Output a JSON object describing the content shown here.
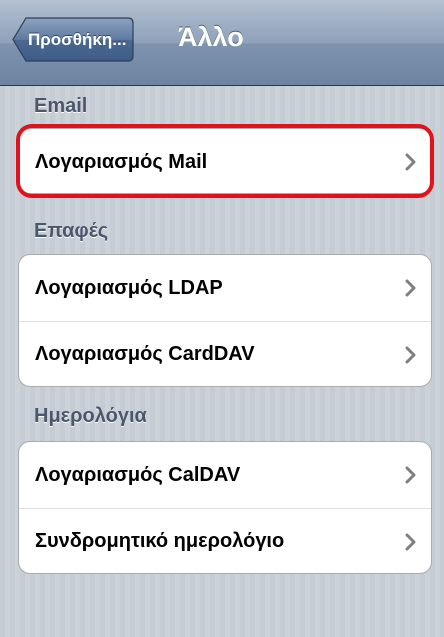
{
  "navbar": {
    "back_label": "Προσθήκη...",
    "title": "Άλλο"
  },
  "sections": [
    {
      "header": "Email",
      "rows": [
        {
          "label": "Λογαριασμός Mail"
        }
      ]
    },
    {
      "header": "Επαφές",
      "rows": [
        {
          "label": "Λογαριασμός LDAP"
        },
        {
          "label": "Λογαριασμός CardDAV"
        }
      ]
    },
    {
      "header": "Ημερολόγια",
      "rows": [
        {
          "label": "Λογαριασμός CalDAV"
        },
        {
          "label": "Συνδρομητικό ημερολόγιο"
        }
      ]
    }
  ],
  "colors": {
    "highlight": "#e0121b",
    "navbar": "#6d84a2",
    "section_header": "#4c566c"
  }
}
